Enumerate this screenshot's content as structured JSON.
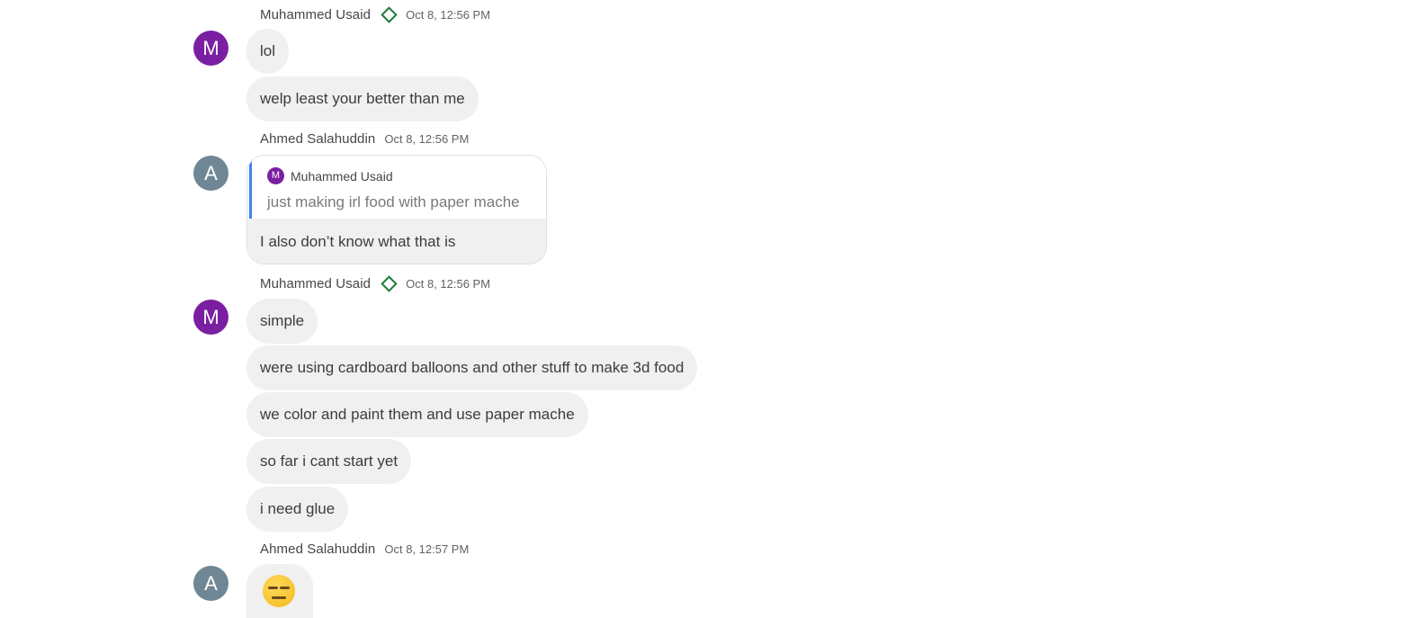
{
  "messages": [
    {
      "sender": "Muhammed Usaid",
      "avatar_letter": "M",
      "verified_icon": "diamond-icon",
      "time": "Oct 8, 12:56 PM",
      "bubbles": [
        "lol",
        "welp least your better than me"
      ]
    },
    {
      "sender": "Ahmed Salahuddin",
      "avatar_letter": "A",
      "time": "Oct 8, 12:56 PM",
      "reply": {
        "author_letter": "M",
        "author": "Muhammed Usaid",
        "quoted_text": "just making irl food with paper mache"
      },
      "body": "I also don’t know what that is"
    },
    {
      "sender": "Muhammed Usaid",
      "avatar_letter": "M",
      "verified_icon": "diamond-icon",
      "time": "Oct 8, 12:56 PM",
      "bubbles": [
        "simple",
        "were using cardboard balloons and other stuff to make 3d food",
        "we color and paint them and use paper mache",
        "so far i cant start yet",
        "i need glue"
      ]
    },
    {
      "sender": "Ahmed Salahuddin",
      "avatar_letter": "A",
      "time": "Oct 8, 12:57 PM",
      "emoji": "expressionless-face-emoji"
    }
  ],
  "colors": {
    "avatar_m": "#7b1fa2",
    "avatar_a": "#6f8794",
    "bubble_bg": "#f0f0f0",
    "reply_bar": "#4285f4",
    "verified": "#1e7a3c"
  }
}
